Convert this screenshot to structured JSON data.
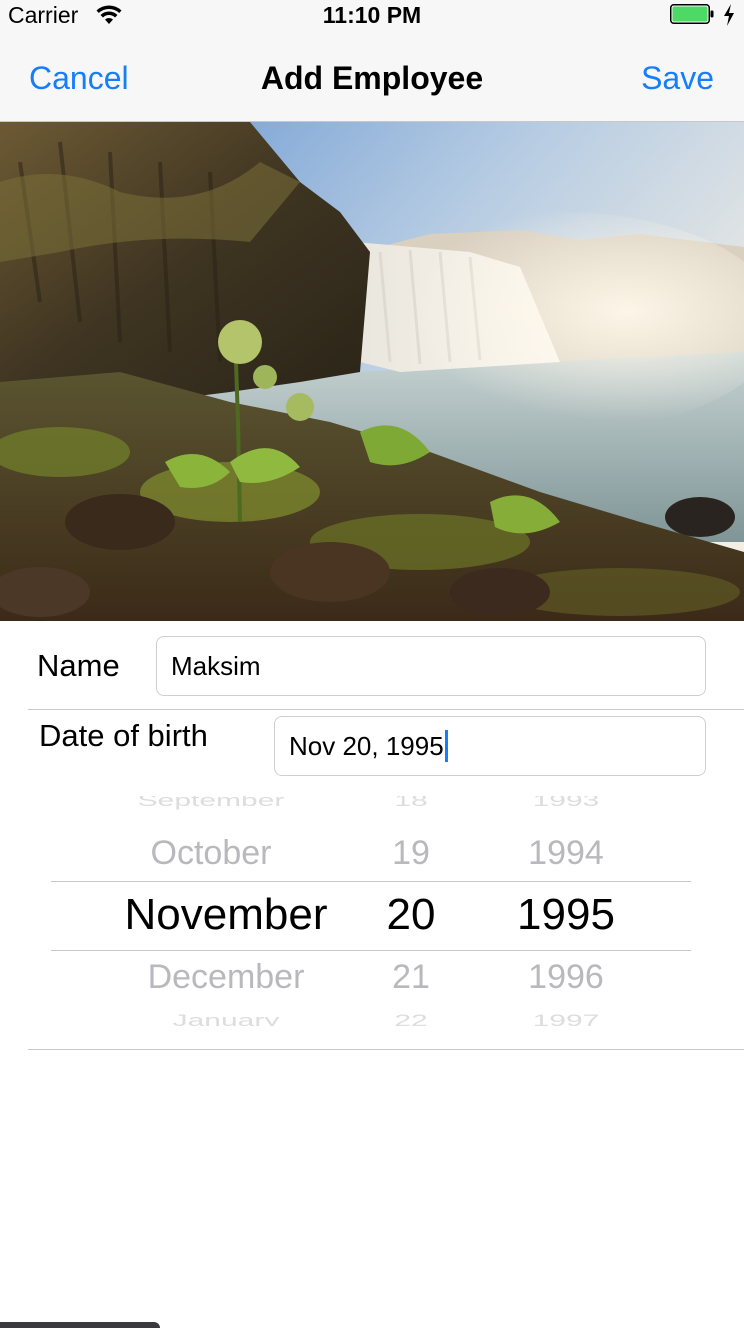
{
  "status_bar": {
    "carrier": "Carrier",
    "time": "11:10 PM",
    "battery_level": 1.0,
    "battery_color": "#4cd964",
    "charging": true
  },
  "nav": {
    "cancel_label": "Cancel",
    "title": "Add Employee",
    "save_label": "Save",
    "tint_color": "#147efb"
  },
  "photo": {
    "subject": "waterfall landscape photo"
  },
  "form": {
    "name_label": "Name",
    "name_value": "Maksim",
    "dob_label": "Date of birth",
    "dob_value": "Nov 20, 1995"
  },
  "date_picker": {
    "month": {
      "above_partial": "September",
      "above": "October",
      "selected": "November",
      "below": "December",
      "below_partial": "January"
    },
    "day": {
      "above_partial": "18",
      "above": "19",
      "selected": "20",
      "below": "21",
      "below_partial": "22"
    },
    "year": {
      "above_partial": "1993",
      "above": "1994",
      "selected": "1995",
      "below": "1996",
      "below_partial": "1997"
    }
  }
}
